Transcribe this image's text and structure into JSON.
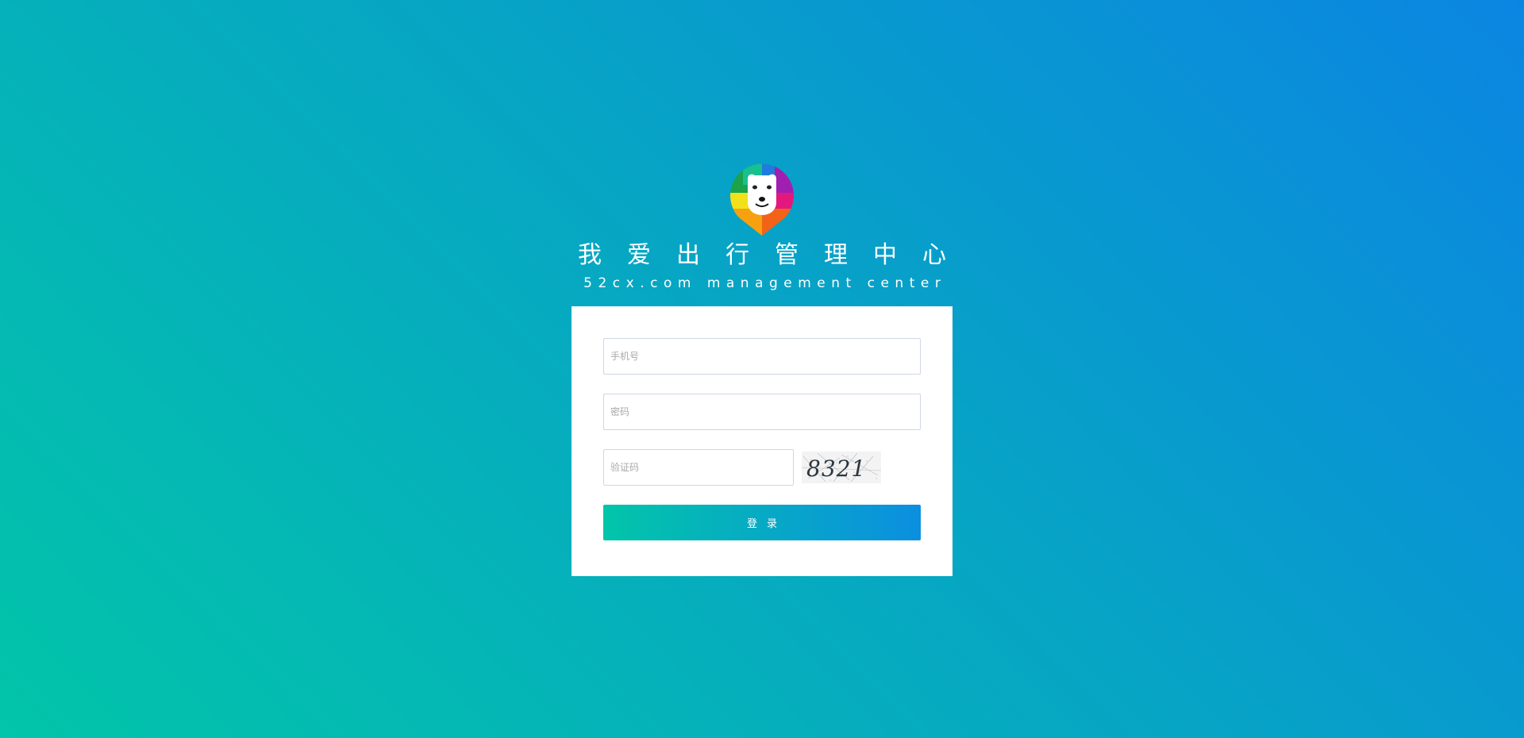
{
  "brand": {
    "title": "我爱出行管理中心",
    "subtitle": "52cx.com management center"
  },
  "form": {
    "phone_placeholder": "手机号",
    "password_placeholder": "密码",
    "captcha_placeholder": "验证码",
    "captcha_text": "8321",
    "login_label": "登录"
  },
  "colors": {
    "background_start": "#02c5a9",
    "background_end": "#0b85e2",
    "card": "#ffffff",
    "input_border": "#cfd6e6"
  },
  "icons": {
    "logo": "bear-logo-icon"
  }
}
